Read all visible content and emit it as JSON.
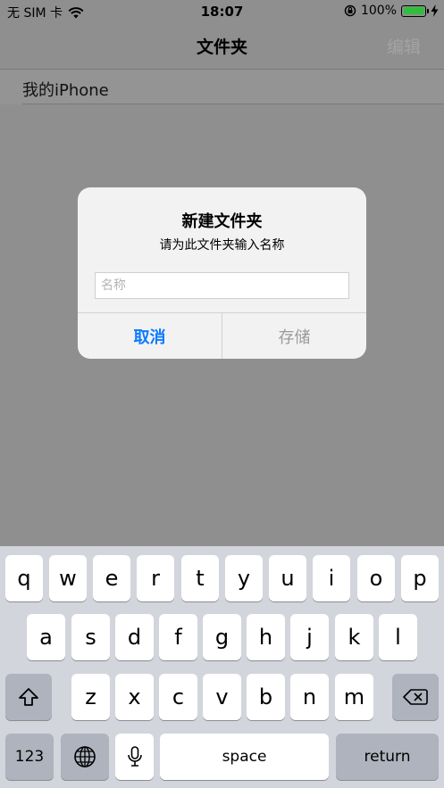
{
  "status_bar": {
    "carrier": "无 SIM 卡",
    "time": "18:07",
    "battery_percent": "100%",
    "wifi_icon": "wifi-icon",
    "lock_icon": "orientation-lock-icon"
  },
  "nav": {
    "title": "文件夹",
    "edit_label": "编辑"
  },
  "list": {
    "items": [
      {
        "label": "我的iPhone"
      }
    ]
  },
  "alert": {
    "title": "新建文件夹",
    "message": "请为此文件夹输入名称",
    "input_placeholder": "名称",
    "input_value": "",
    "cancel_label": "取消",
    "save_label": "存储"
  },
  "keyboard": {
    "row1": [
      "q",
      "w",
      "e",
      "r",
      "t",
      "y",
      "u",
      "i",
      "o",
      "p"
    ],
    "row2": [
      "a",
      "s",
      "d",
      "f",
      "g",
      "h",
      "j",
      "k",
      "l"
    ],
    "row3": [
      "z",
      "x",
      "c",
      "v",
      "b",
      "n",
      "m"
    ],
    "numbers_label": "123",
    "space_label": "space",
    "return_label": "return"
  },
  "colors": {
    "accent": "#0a7aff",
    "battery": "#2fbf3a",
    "dimmed_background": "#8f8f8f",
    "keyboard_background": "#d2d5db"
  }
}
